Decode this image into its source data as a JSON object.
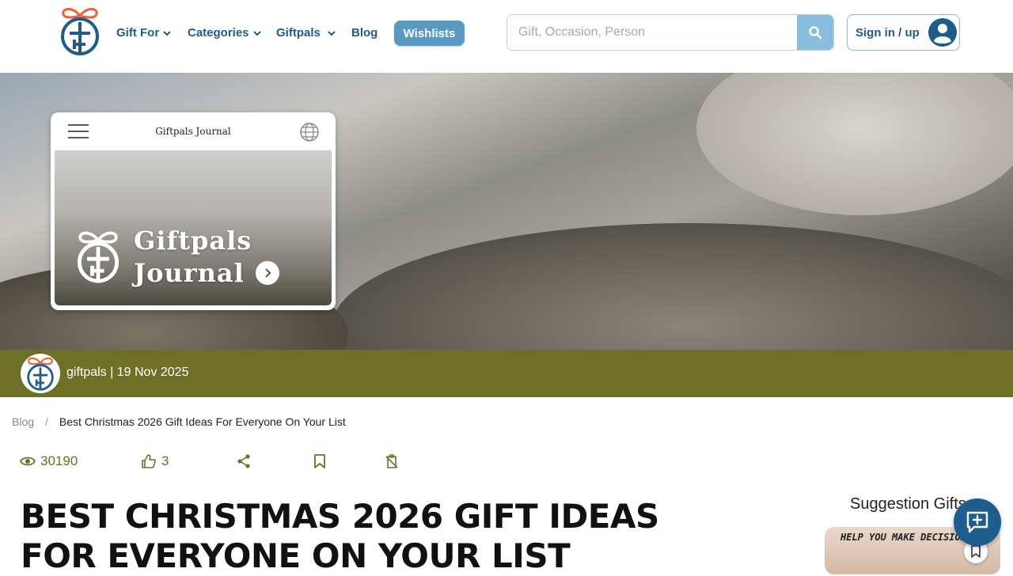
{
  "header": {
    "nav": {
      "gift_for": "Gift For",
      "categories": "Categories",
      "giftpals": "Giftpals",
      "blog": "Blog",
      "wishlists": "Wishlists"
    },
    "search": {
      "placeholder": "Gift, Occasion, Person"
    },
    "signin_label": "Sign in / up"
  },
  "hero": {
    "journal_title": "Giftpals Journal",
    "brand_line1": "Giftpals",
    "brand_line2": "Journal"
  },
  "author": {
    "text": "giftpals | 19 Nov 2025"
  },
  "breadcrumb": {
    "root": "Blog",
    "separator": "/",
    "current": "Best Christmas 2026 Gift Ideas For Everyone On Your List"
  },
  "stats": {
    "views": "30190",
    "likes": "3"
  },
  "article": {
    "title": "BEST CHRISTMAS 2026 GIFT IDEAS FOR EVERYONE ON YOUR LIST"
  },
  "sidebar": {
    "title": "Suggestion Gifts",
    "card_text": "HELP YOU MAKE DECISIONS"
  },
  "colors": {
    "brand_blue": "#1f5c8a",
    "olive": "#6e7028",
    "logo_orange": "#e8643a",
    "search_btn": "#89bde0"
  }
}
